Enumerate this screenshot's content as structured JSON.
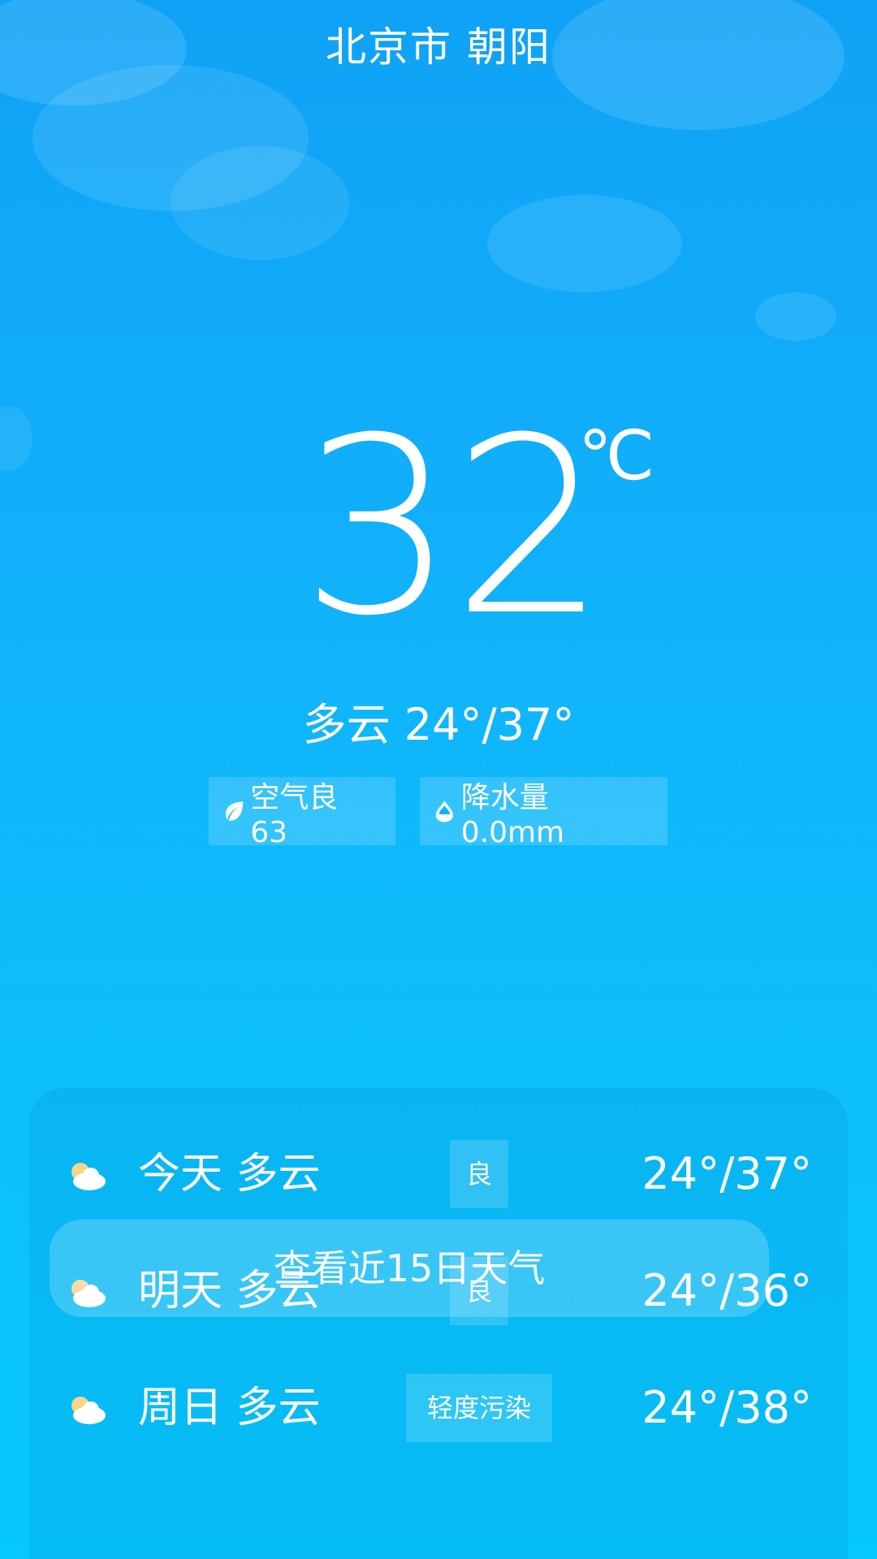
{
  "header": {
    "city": "北京市 朝阳"
  },
  "current": {
    "temperature": "32",
    "unit": "℃",
    "summary": "多云 24°/37°"
  },
  "chips": {
    "aqi": {
      "icon": "leaf-icon",
      "label": "空气良 63"
    },
    "rain": {
      "icon": "raindrop-icon",
      "label": "降水量 0.0mm"
    }
  },
  "forecast": [
    {
      "icon": "partly-cloudy-icon",
      "day": "今天 多云",
      "aqi": "良",
      "range": "24°/37°"
    },
    {
      "icon": "partly-cloudy-icon",
      "day": "明天 多云",
      "aqi": "良",
      "range": "24°/36°"
    },
    {
      "icon": "partly-cloudy-icon",
      "day": "周日 多云",
      "aqi": "轻度污染",
      "range": "24°/38°"
    }
  ],
  "button_15": "查看近15日天气",
  "colors": {
    "sky_top": "#0fa2f6",
    "sky_bottom": "#06c9fd",
    "sun": "#f7d58a",
    "cloud": "#ffffff"
  }
}
